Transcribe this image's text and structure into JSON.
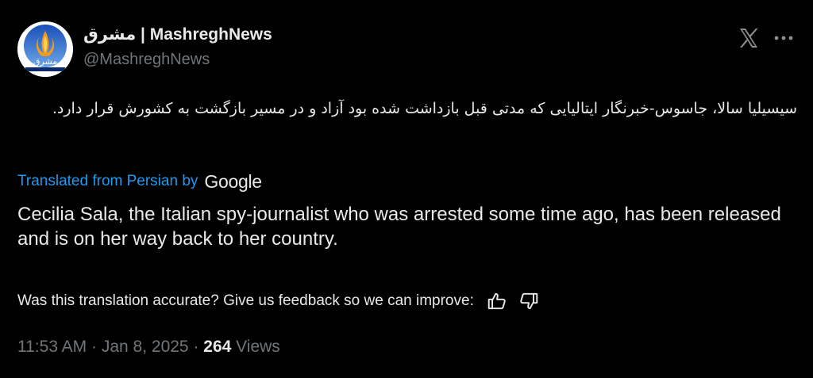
{
  "author": {
    "display_name": "مشرق | MashreghNews",
    "handle": "@MashreghNews",
    "avatar_text": "مشرق"
  },
  "header": {
    "x_icon": "x-logo-icon",
    "more_icon": "more-horizontal-icon"
  },
  "tweet": {
    "original_text": "سیسیلیا سالا، جاسوس-خبرنگار ایتالیایی که مدتی قبل بازداشت شده بود آزاد و در مسیر بازگشت به کشورش قرار دارد.",
    "translated_from_label": "Translated from Persian by",
    "translator_brand": "Google",
    "translation": "Cecilia Sala, the Italian spy-journalist who was arrested some time ago, has been released and is on her way back to her country."
  },
  "feedback": {
    "prompt": "Was this translation accurate? Give us feedback so we can improve:",
    "thumbs_up_icon": "thumbs-up-icon",
    "thumbs_down_icon": "thumbs-down-icon"
  },
  "meta": {
    "time": "11:53 AM",
    "separator": " · ",
    "date": "Jan 8, 2025",
    "views_count": "264",
    "views_label": " Views"
  },
  "colors": {
    "background": "#000000",
    "text": "#e7e9ea",
    "secondary": "#71767b",
    "link": "#1d9bf0"
  }
}
